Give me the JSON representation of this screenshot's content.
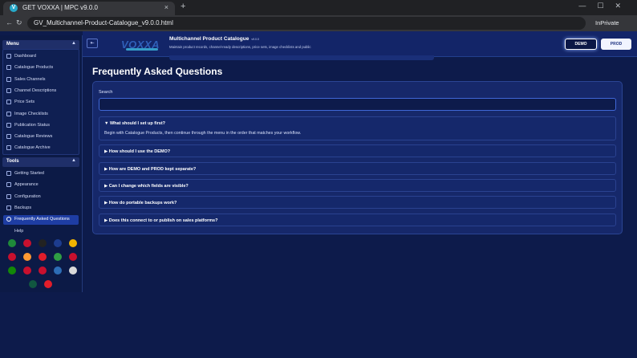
{
  "browser": {
    "tab_title": "GET VOXXA | MPC v9.0.0",
    "tab_favicon": "V",
    "close_glyph": "×",
    "newtab_glyph": "+",
    "window_controls": "—☐✕",
    "back_glyph": "←",
    "reload_glyph": "↻",
    "url": "GV_Multichannel-Product-Catalogue_v9.0.0.html",
    "inprivate": "InPrivate"
  },
  "sidebar": {
    "menu_label": "Menu",
    "tools_label": "Tools",
    "chevron": "▲",
    "menu_items": [
      {
        "label": "Dashboard"
      },
      {
        "label": "Catalogue Products"
      },
      {
        "label": "Sales Channels"
      },
      {
        "label": "Channel Descriptions"
      },
      {
        "label": "Price Sets"
      },
      {
        "label": "Image Checklists"
      },
      {
        "label": "Publication Status"
      },
      {
        "label": "Catalogue Reviews"
      },
      {
        "label": "Catalogue Archive"
      }
    ],
    "tool_items": [
      {
        "label": "Getting Started"
      },
      {
        "label": "Appearance"
      },
      {
        "label": "Configuration"
      },
      {
        "label": "Backups"
      },
      {
        "label": "Frequently Asked Questions"
      },
      {
        "label": "Help"
      }
    ],
    "flag_colors": [
      [
        "#1f8a3a",
        "#c8102e",
        "#222222",
        "#1d3c8f",
        "#f1b400"
      ],
      [
        "#c8102e",
        "#ff9933",
        "#e11d2a",
        "#2f9e44",
        "#c8102e"
      ],
      [
        "#138808",
        "#c8102e",
        "#c8102e",
        "#2d6db5",
        "#d9d9d9"
      ],
      [
        "#115740",
        "#e11d2a"
      ]
    ]
  },
  "header": {
    "collapse_glyph": "⇤",
    "logo_text": "VOXXA",
    "title": "Multichannel Product Catalogue",
    "version": "v9.0.0",
    "subtitle": "Maintain product records, channel-ready descriptions, price sets, image checklists and public",
    "demo_label": "DEMO",
    "prod_label": "PROD"
  },
  "main": {
    "page_title": "Frequently Asked Questions",
    "search_label": "Search",
    "search_value": "",
    "search_placeholder": "",
    "faqs": [
      {
        "marker": "▼",
        "question": "What should I set up first?",
        "answer": "Begin with Catalogue Products, then continue through the menu in the order that matches your workflow.",
        "open": true
      },
      {
        "marker": "▶",
        "question": "How should I use the DEMO?",
        "open": false
      },
      {
        "marker": "▶",
        "question": "How are DEMO and PROD kept separate?",
        "open": false
      },
      {
        "marker": "▶",
        "question": "Can I change which fields are visible?",
        "open": false
      },
      {
        "marker": "▶",
        "question": "How do portable backups work?",
        "open": false
      },
      {
        "marker": "▶",
        "question": "Does this connect to or publish on sales platforms?",
        "open": false
      }
    ]
  },
  "colors": {
    "accent": "#3f67d6",
    "active_item": "#1e3da3",
    "background": "#0d1b4b"
  }
}
